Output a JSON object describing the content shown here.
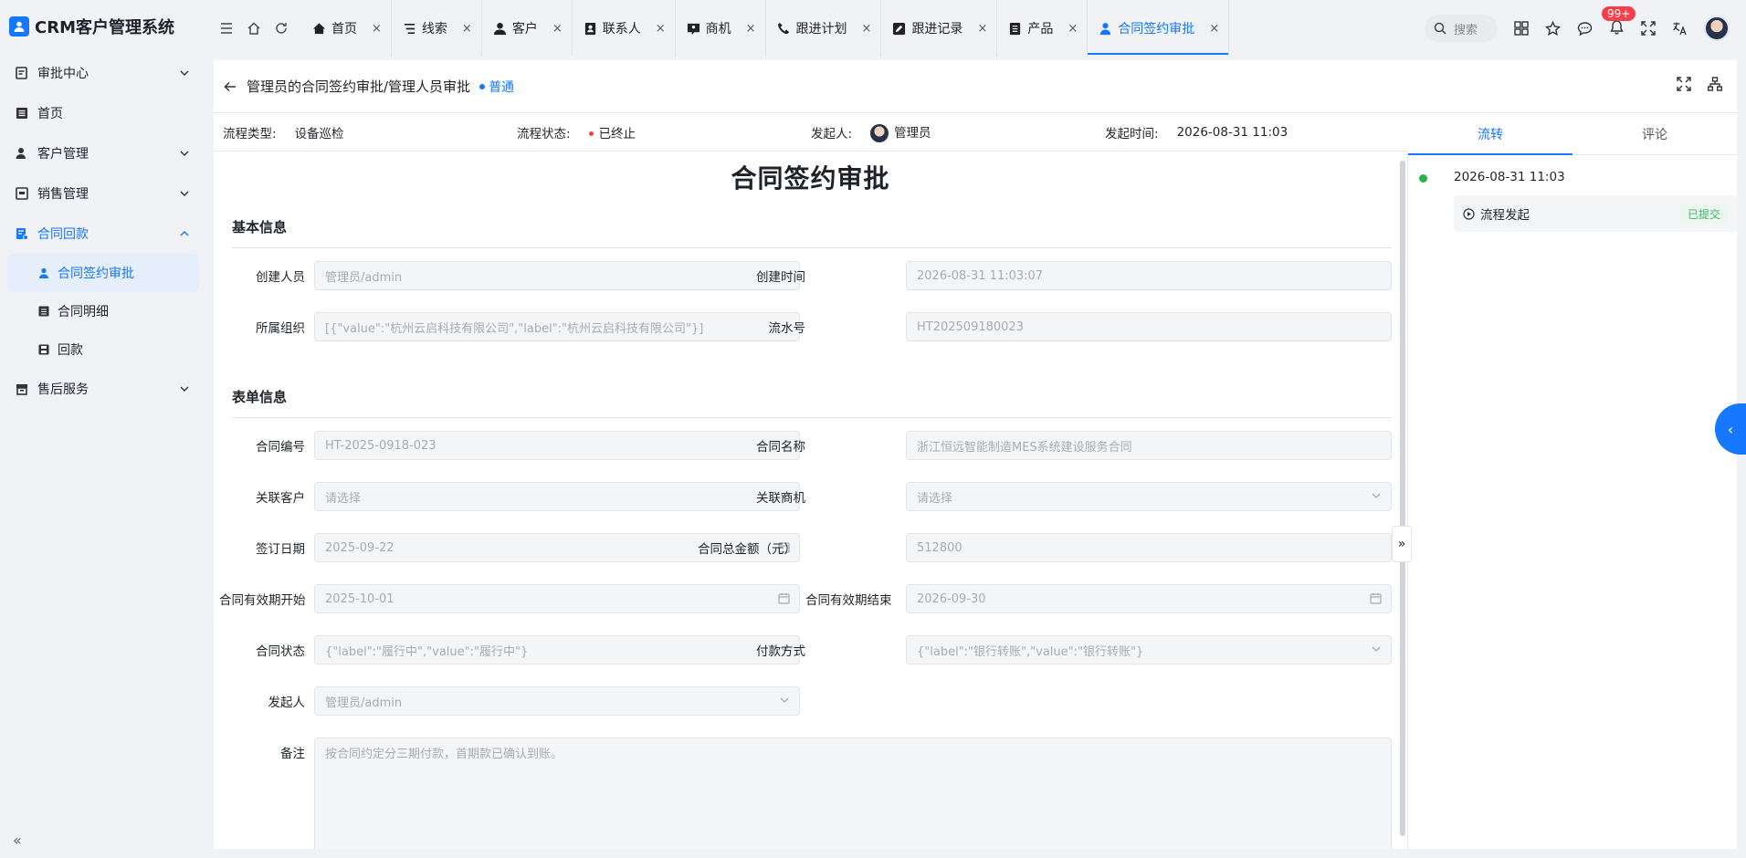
{
  "app": {
    "title": "CRM客户管理系统"
  },
  "sidebar": {
    "items": [
      {
        "label": "审批中心",
        "icon": "approval-icon",
        "expandable": true
      },
      {
        "label": "首页",
        "icon": "home-list-icon",
        "expandable": false
      },
      {
        "label": "客户管理",
        "icon": "user-manage-icon",
        "expandable": true
      },
      {
        "label": "销售管理",
        "icon": "sales-box-icon",
        "expandable": true
      },
      {
        "label": "合同回款",
        "icon": "contract-icon",
        "expandable": true,
        "expanded": true
      },
      {
        "label": "售后服务",
        "icon": "service-box-icon",
        "expandable": true
      }
    ],
    "sub_items": [
      {
        "label": "合同签约审批",
        "active": true
      },
      {
        "label": "合同明细",
        "active": false
      },
      {
        "label": "回款",
        "active": false
      }
    ]
  },
  "tabs": [
    {
      "label": "首页",
      "icon": "home-icon"
    },
    {
      "label": "线索",
      "icon": "clue-icon"
    },
    {
      "label": "客户",
      "icon": "customer-icon"
    },
    {
      "label": "联系人",
      "icon": "contact-icon"
    },
    {
      "label": "商机",
      "icon": "opportunity-icon"
    },
    {
      "label": "跟进计划",
      "icon": "phone-icon"
    },
    {
      "label": "跟进记录",
      "icon": "edit-icon"
    },
    {
      "label": "产品",
      "icon": "product-icon"
    },
    {
      "label": "合同签约审批",
      "icon": "user-icon",
      "active": true
    }
  ],
  "header": {
    "search_placeholder": "搜索",
    "notif_badge": "99+"
  },
  "detail": {
    "title": "管理员的合同签约审批/管理人员审批",
    "level": "普通",
    "info": {
      "type_label": "流程类型:",
      "type_value": "设备巡检",
      "status_label": "流程状态:",
      "status_value": "已终止",
      "initiator_label": "发起人:",
      "initiator_value": "管理员",
      "time_label": "发起时间:",
      "time_value": "2026-08-31 11:03"
    },
    "form_title": "合同签约审批",
    "sections": {
      "basic": "基本信息",
      "form": "表单信息"
    },
    "fields": {
      "creator": {
        "label": "创建人员",
        "value": "管理员/admin"
      },
      "created_time": {
        "label": "创建时间",
        "value": "2026-08-31 11:03:07"
      },
      "org": {
        "label": "所属组织",
        "value": "[{\"value\":\"杭州云启科技有限公司\",\"label\":\"杭州云启科技有限公司\"}]"
      },
      "serial": {
        "label": "流水号",
        "value": "HT202509180023"
      },
      "contract_no": {
        "label": "合同编号",
        "value": "HT-2025-0918-023"
      },
      "contract_name": {
        "label": "合同名称",
        "value": "浙江恒远智能制造MES系统建设服务合同"
      },
      "customer": {
        "label": "关联客户",
        "placeholder": "请选择"
      },
      "opportunity": {
        "label": "关联商机",
        "placeholder": "请选择"
      },
      "sign_date": {
        "label": "签订日期",
        "value": "2025-09-22"
      },
      "amount": {
        "label": "合同总金额（元）",
        "value": "512800"
      },
      "start": {
        "label": "合同有效期开始",
        "value": "2025-10-01"
      },
      "end": {
        "label": "合同有效期结束",
        "value": "2026-09-30"
      },
      "status": {
        "label": "合同状态",
        "value": "{\"label\":\"履行中\",\"value\":\"履行中\"}"
      },
      "payment": {
        "label": "付款方式",
        "value": "{\"label\":\"银行转账\",\"value\":\"银行转账\"}"
      },
      "initiator": {
        "label": "发起人",
        "value": "管理员/admin"
      },
      "remark": {
        "label": "备注",
        "value": "按合同约定分三期付款，首期款已确认到账。"
      }
    }
  },
  "flow": {
    "tabs": [
      "流转",
      "评论"
    ],
    "time": "2026-08-31 11:03",
    "step": "流程发起",
    "step_status": "已提交"
  },
  "colors": {
    "accent": "#1677ff",
    "success": "#2bb24c",
    "danger": "#f5404c"
  }
}
